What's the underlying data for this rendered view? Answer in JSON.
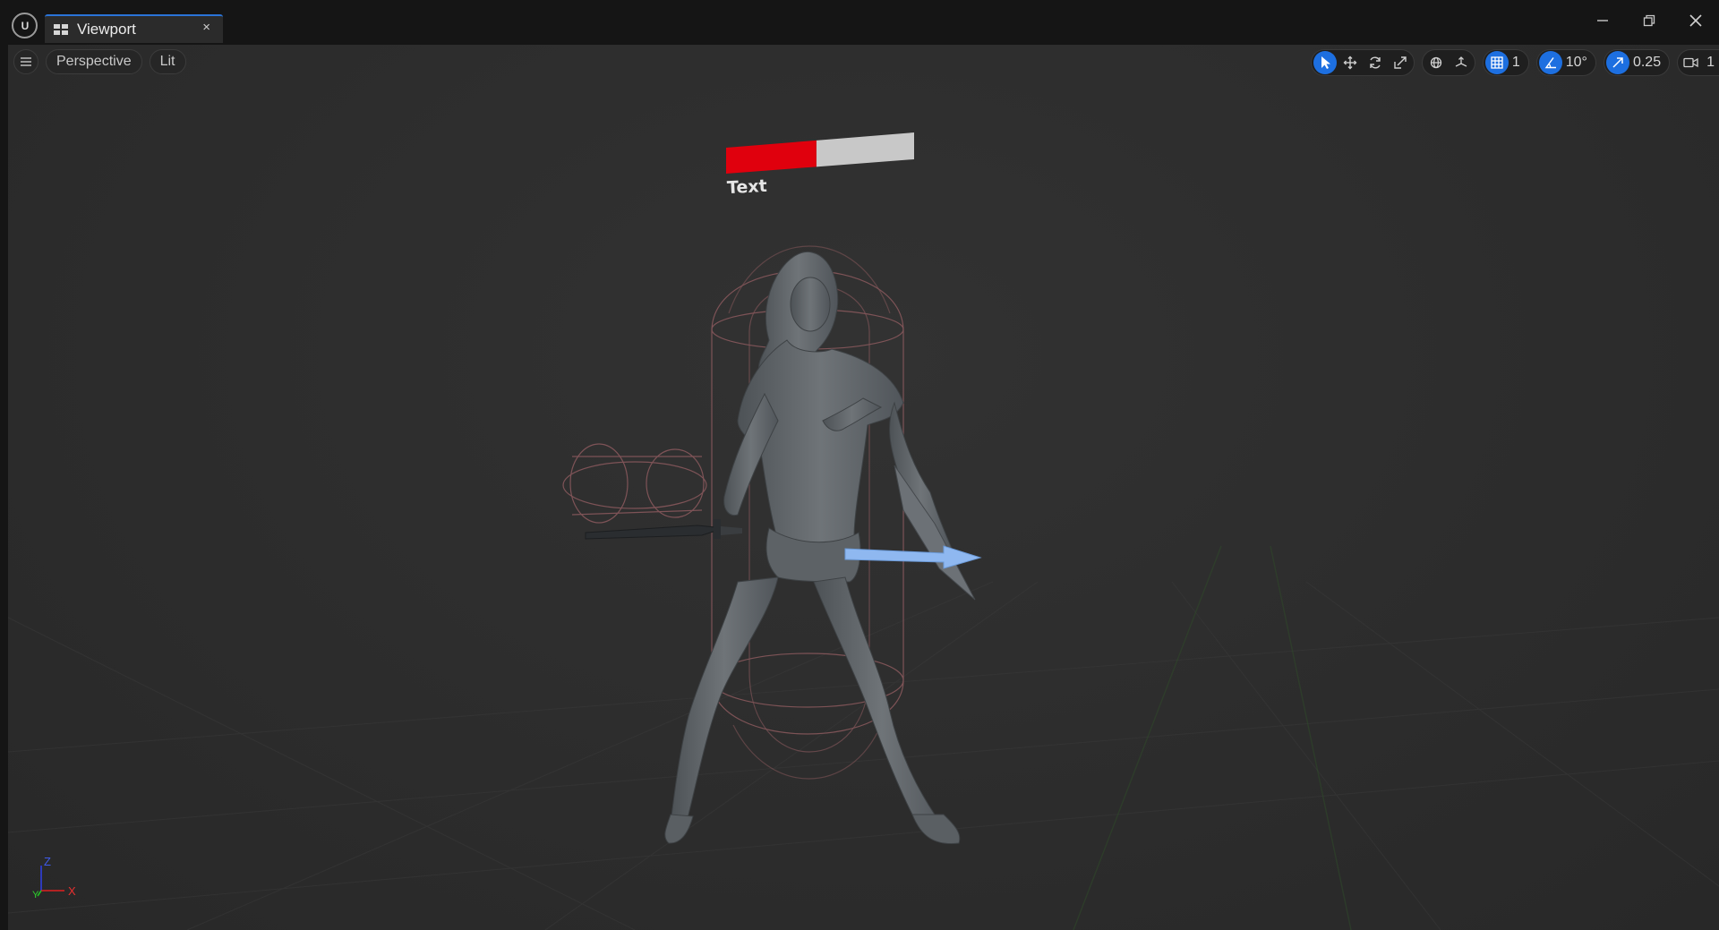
{
  "app": {
    "logo_text": "U",
    "tab_title": "Viewport",
    "tab_close": "×"
  },
  "window_controls": {
    "minimize": "minimize-icon",
    "restore": "restore-icon",
    "close": "close-icon"
  },
  "viewport": {
    "menu_icon": "hamburger-icon",
    "view_mode": "Perspective",
    "lighting_mode": "Lit",
    "toolbar": {
      "select_tool": "select-arrow-icon",
      "translate_tool": "translate-icon",
      "rotate_tool": "rotate-icon",
      "scale_tool": "scale-icon",
      "world_local_toggle": "world-icon",
      "surface_snapping": "surface-snap-icon",
      "grid_snap_value": "1",
      "rotation_snap_value": "10°",
      "scale_snap_value": "0.25",
      "camera_speed_value": "1"
    },
    "accent_color": "#1d6fe0",
    "health_bar": {
      "fill_fraction": 0.48,
      "fill_color": "#e0000d",
      "empty_color": "#c8c8c8",
      "label": "Text"
    },
    "axis_gizmo": {
      "z": "Z",
      "y": "Y",
      "x": "X"
    }
  }
}
